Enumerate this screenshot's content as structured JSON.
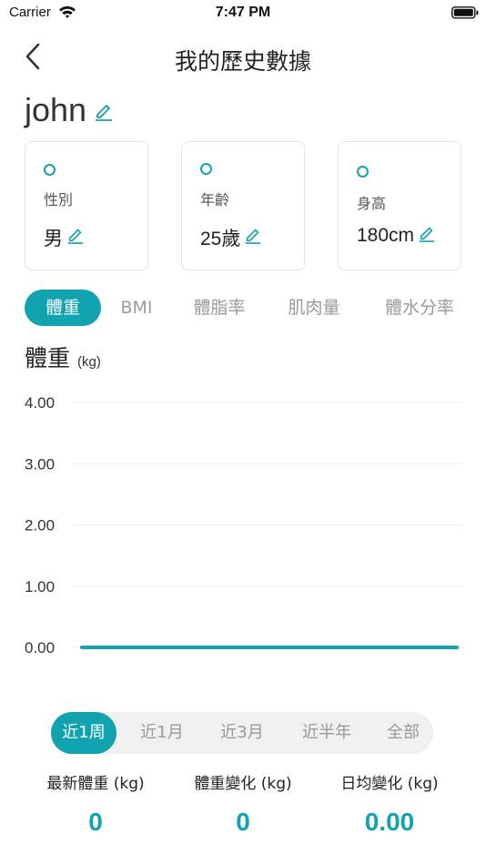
{
  "status_bar": {
    "carrier": "Carrier",
    "time": "7:47 PM"
  },
  "nav": {
    "title": "我的歷史數據"
  },
  "user": {
    "name": "john"
  },
  "info_cards": [
    {
      "label": "性別",
      "value": "男"
    },
    {
      "label": "年齡",
      "value": "25歲"
    },
    {
      "label": "身高",
      "value": "180cm"
    }
  ],
  "metric_tabs": [
    {
      "label": "體重",
      "active": true
    },
    {
      "label": "BMI",
      "active": false
    },
    {
      "label": "體脂率",
      "active": false
    },
    {
      "label": "肌肉量",
      "active": false
    },
    {
      "label": "體水分率",
      "active": false
    }
  ],
  "chart_header": {
    "title": "體重",
    "unit": "(kg)"
  },
  "chart_data": {
    "type": "line",
    "title": "",
    "xlabel": "",
    "ylabel": "",
    "ylim": [
      0,
      4
    ],
    "y_ticks": [
      "4.00",
      "3.00",
      "2.00",
      "1.00",
      "0.00"
    ],
    "x": [
      0,
      1
    ],
    "series": [
      {
        "values": [
          0,
          0
        ]
      }
    ],
    "grid": true
  },
  "range_tabs": [
    {
      "label": "近1周",
      "active": true
    },
    {
      "label": "近1月",
      "active": false
    },
    {
      "label": "近3月",
      "active": false
    },
    {
      "label": "近半年",
      "active": false
    },
    {
      "label": "全部",
      "active": false
    }
  ],
  "stats": [
    {
      "label": "最新體重 (kg)",
      "value": "0"
    },
    {
      "label": "體重變化 (kg)",
      "value": "0"
    },
    {
      "label": "日均變化 (kg)",
      "value": "0.00"
    }
  ],
  "colors": {
    "accent": "#12a3b0",
    "inactive_text": "#9a9a9a",
    "range_bg": "#f0f0f0",
    "grid": "#eeeeee"
  }
}
